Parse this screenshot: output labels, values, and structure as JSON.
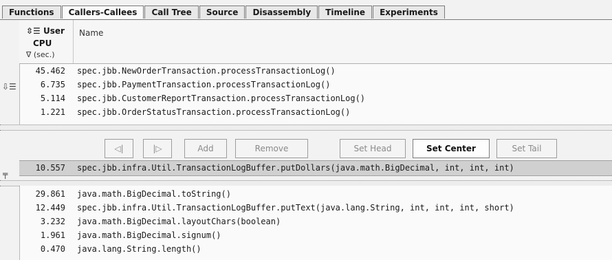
{
  "tabs": [
    "Functions",
    "Callers-Callees",
    "Call Tree",
    "Source",
    "Disassembly",
    "Timeline",
    "Experiments"
  ],
  "header": {
    "metric_line1": "User",
    "metric_line2": "CPU",
    "metric_line3": "∇ (sec.)",
    "name_label": "Name"
  },
  "callers": [
    {
      "value": "45.462",
      "name": "spec.jbb.NewOrderTransaction.processTransactionLog()"
    },
    {
      "value": "6.735",
      "name": "spec.jbb.PaymentTransaction.processTransactionLog()"
    },
    {
      "value": "5.114",
      "name": "spec.jbb.CustomerReportTransaction.processTransactionLog()"
    },
    {
      "value": "1.221",
      "name": "spec.jbb.OrderStatusTransaction.processTransactionLog()"
    }
  ],
  "toolbar": {
    "back": "◁|",
    "forward": "|▷",
    "add": "Add",
    "remove": "Remove",
    "set_head": "Set Head",
    "set_center": "Set Center",
    "set_tail": "Set Tail"
  },
  "center": {
    "value": "10.557",
    "name": "spec.jbb.infra.Util.TransactionLogBuffer.putDollars(java.math.BigDecimal, int, int, int)"
  },
  "callees": [
    {
      "value": "29.861",
      "name": "java.math.BigDecimal.toString()"
    },
    {
      "value": "12.449",
      "name": "spec.jbb.infra.Util.TransactionLogBuffer.putText(java.lang.String, int, int, int, short)"
    },
    {
      "value": "3.232",
      "name": "java.math.BigDecimal.layoutChars(boolean)"
    },
    {
      "value": "1.961",
      "name": "java.math.BigDecimal.signum()"
    },
    {
      "value": "0.470",
      "name": "java.lang.String.length()"
    }
  ]
}
